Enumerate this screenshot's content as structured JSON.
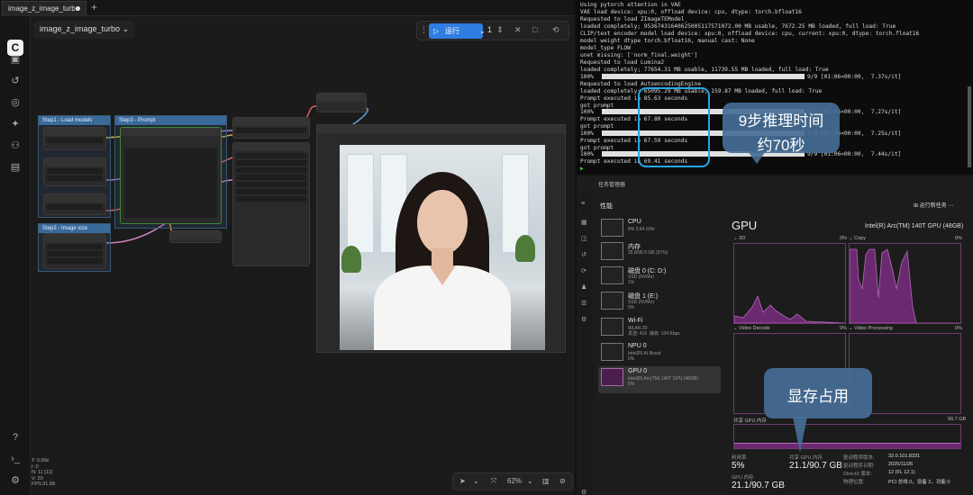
{
  "comfy": {
    "tab_title": "image_z_image_turbo",
    "workflow_title": "image_z_image_turbo",
    "run_label": "运行",
    "run_count": "1",
    "groups": [
      {
        "title": "Step1 - Load models"
      },
      {
        "title": "Step2 - Image size"
      },
      {
        "title": "Step3 - Prompt"
      }
    ],
    "zoom": "62%",
    "status_lines": [
      "T: 0.00s",
      "I: 0",
      "N: 11 [11]",
      "V: 20",
      "FPS:31.58"
    ]
  },
  "terminal": {
    "lines": [
      "Using pytorch attention in VAE",
      "VAE load device: xpu:0, offload device: cpu, dtype: torch.bfloat16",
      "Requested to load ZImageTEModel_",
      "loaded completely; 95367431640625005117571072.00 MB usable, 7672.25 MB loaded, full load: True",
      "CLIP/text encoder model load device: xpu:0, offload device: cpu, current: xpu:0, dtype: torch.float16",
      "model weight dtype torch.bfloat16, manual cast: None",
      "model_type FLOW",
      "unet missing: ['norm_final.weight']",
      "Requested to load Lumina2",
      "loaded completely; 77654.31 MB usable, 11739.55 MB loaded, full load: True"
    ],
    "progress_rows": [
      {
        "pct": "100%",
        "stats": "9/9 [01:06<00:00,  7.37s/it]"
      },
      {
        "pct": "100%",
        "stats": "9/9 [01:05<00:00,  7.27s/it]"
      },
      {
        "pct": "100%",
        "stats": "9/9 [01:06<00:00,  7.25s/it]"
      },
      {
        "pct": "100%",
        "stats": "9/9 [01:06<00:00,  7.44s/it]"
      }
    ],
    "extra_lines": [
      "Requested to load AutoencodingEngine",
      "loaded completely; 65095.29 MB usable, 159.87 MB loaded, full load: True"
    ],
    "prompt_executed": [
      "Prompt executed in 85.63 seconds",
      "Prompt executed in 67.80 seconds",
      "Prompt executed in 67.59 seconds",
      "Prompt executed in 69.41 seconds"
    ],
    "got_prompt": "got prompt"
  },
  "annotations": {
    "inference_time_l1": "9步推理时间",
    "inference_time_l2": "约70秒",
    "vram_usage": "显存占用"
  },
  "taskmgr": {
    "window_title": "任务管理器",
    "section": "性能",
    "run_new_task": "运行新任务",
    "devices": [
      {
        "name": "CPU",
        "sub": "8% 3.64 GHz"
      },
      {
        "name": "内存",
        "sub": "35.8/95.5 GB (37%)"
      },
      {
        "name": "磁盘 0 (C: D:)",
        "sub": "SSD (NVMe)\n1%"
      },
      {
        "name": "磁盘 1 (E:)",
        "sub": "SSD (NVMe)\n0%"
      },
      {
        "name": "Wi-Fi",
        "sub": "WLAN 20\n发送: 416  接收: 104 Kbps"
      },
      {
        "name": "NPU 0",
        "sub": "Intel(R) AI Boost\n0%"
      },
      {
        "name": "GPU 0",
        "sub": "Intel(R) Arc(TM) 140T GPU (48GB)\n5%"
      }
    ],
    "gpu_title": "GPU",
    "gpu_model": "Intel(R) Arc(TM) 140T GPU (48GB)",
    "graphs": [
      {
        "label": "3D",
        "pct": "0%"
      },
      {
        "label": "Copy",
        "pct": "0%"
      },
      {
        "label": "Video Decode",
        "pct": "0%"
      },
      {
        "label": "Video Processing",
        "pct": "0%"
      }
    ],
    "shared_mem_label": "共享 GPU 内存",
    "shared_mem_max": "90.7 GB",
    "util_label": "利用率",
    "util_value": "5%",
    "shared_label": "共享 GPU 内存",
    "shared_value": "21.1/90.7 GB",
    "gpu_mem_label": "GPU 内存",
    "gpu_mem_value": "21.1/90.7 GB",
    "driver": [
      {
        "k": "驱动程序版本:",
        "v": "32.0.101.8331"
      },
      {
        "k": "驱动程序日期:",
        "v": "2025/11/26"
      },
      {
        "k": "DirectX 版本:",
        "v": "12 (FL 12.1)"
      },
      {
        "k": "物理位置:",
        "v": "PCI 总线 0，设备 2，功能 0"
      }
    ]
  }
}
